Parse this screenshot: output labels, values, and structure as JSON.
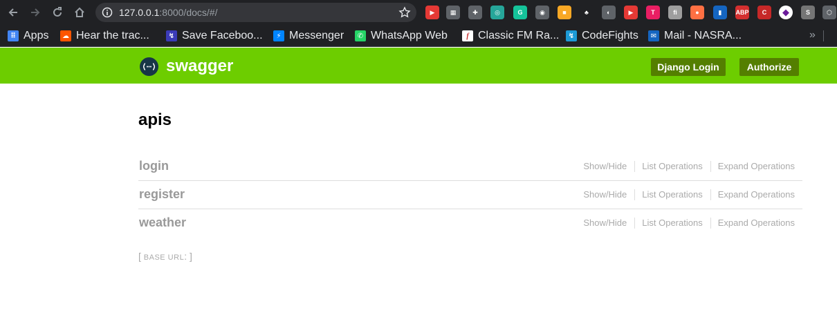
{
  "browser": {
    "url_host": "127.0.0.1",
    "url_rest": ":8000/docs/#/",
    "extensions": [
      {
        "name": "extension-red-arrow-icon",
        "color": "#e53935",
        "glyph": "▶"
      },
      {
        "name": "extension-grid-icon",
        "color": "#5f6368",
        "glyph": "▦"
      },
      {
        "name": "extension-puzzle-icon",
        "color": "#5f6368",
        "glyph": "✚"
      },
      {
        "name": "extension-compass-icon",
        "color": "#26a69a",
        "glyph": "◎"
      },
      {
        "name": "extension-grammarly-icon",
        "color": "#15c39a",
        "glyph": "G"
      },
      {
        "name": "extension-camera-icon",
        "color": "#5f6368",
        "glyph": "◉"
      },
      {
        "name": "extension-lock-icon",
        "color": "#f9a825",
        "glyph": "■"
      },
      {
        "name": "extension-gnome-icon",
        "color": "#202124",
        "glyph": "♣"
      },
      {
        "name": "extension-contrast-icon",
        "color": "#5f6368",
        "glyph": "◐"
      },
      {
        "name": "extension-youtube-icon",
        "color": "#e53935",
        "glyph": "▶"
      },
      {
        "name": "extension-t-icon",
        "color": "#e91e63",
        "glyph": "T"
      },
      {
        "name": "extension-font-icon",
        "color": "#9e9e9e",
        "glyph": "fi"
      },
      {
        "name": "extension-basketball-icon",
        "color": "#ff7043",
        "glyph": "●"
      },
      {
        "name": "extension-chart-icon",
        "color": "#1565c0",
        "glyph": "▮"
      },
      {
        "name": "extension-adblock-icon",
        "color": "#d32f2f",
        "glyph": "ABP"
      },
      {
        "name": "extension-red-c-icon",
        "color": "#c62828",
        "glyph": "C"
      },
      {
        "name": "extension-purple-diamond-icon",
        "color": "#ffffff",
        "glyph": "◆"
      },
      {
        "name": "extension-s-icon",
        "color": "#757575",
        "glyph": "S"
      },
      {
        "name": "extension-cube-icon",
        "color": "#5f6368",
        "glyph": "⬡"
      }
    ]
  },
  "bookmarks": {
    "items": [
      {
        "name": "bookmark-apps",
        "label": "Apps",
        "color": "#4285f4",
        "glyph": "⠿"
      },
      {
        "name": "bookmark-soundcloud",
        "label": "Hear the trac...",
        "color": "#ff5500",
        "glyph": "☁"
      },
      {
        "name": "bookmark-save-facebook",
        "label": "Save Faceboo...",
        "color": "#3b3bb8",
        "glyph": "↯"
      },
      {
        "name": "bookmark-messenger",
        "label": "Messenger",
        "color": "#0084ff",
        "glyph": "⚡"
      },
      {
        "name": "bookmark-whatsapp",
        "label": "WhatsApp Web",
        "color": "#25d366",
        "glyph": "✆"
      },
      {
        "name": "bookmark-classic-fm",
        "label": "Classic FM Ra...",
        "color": "#ffffff",
        "glyph": "f"
      },
      {
        "name": "bookmark-codefights",
        "label": "CodeFights",
        "color": "#1d9ad6",
        "glyph": "↯"
      },
      {
        "name": "bookmark-mail",
        "label": "Mail - NASRA...",
        "color": "#1565c0",
        "glyph": "✉"
      }
    ],
    "more": "»"
  },
  "swagger": {
    "title": "swagger",
    "logo_glyph": "{...}",
    "brand_color": "#6dcd00",
    "button_color": "#547f00",
    "django_login": "Django Login",
    "authorize": "Authorize"
  },
  "main": {
    "title": "apis",
    "resources": [
      {
        "name": "login",
        "ops": [
          "Show/Hide",
          "List Operations",
          "Expand Operations"
        ]
      },
      {
        "name": "register",
        "ops": [
          "Show/Hide",
          "List Operations",
          "Expand Operations"
        ]
      },
      {
        "name": "weather",
        "ops": [
          "Show/Hide",
          "List Operations",
          "Expand Operations"
        ]
      }
    ],
    "base_url_open": "[ ",
    "base_url_label": "base url",
    "base_url_close": ": ]"
  }
}
